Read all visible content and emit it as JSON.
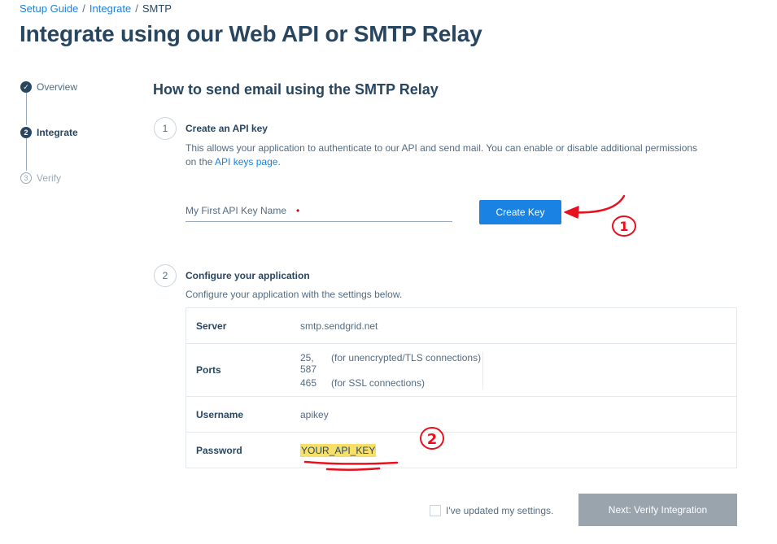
{
  "breadcrumb": {
    "items": [
      "Setup Guide",
      "Integrate",
      "SMTP"
    ],
    "separator": "/"
  },
  "page_title": "Integrate using our Web API or SMTP Relay",
  "steps": [
    {
      "label": "Overview",
      "status": "done",
      "marker": "✓"
    },
    {
      "label": "Integrate",
      "status": "active",
      "marker": "2"
    },
    {
      "label": "Verify",
      "status": "pending",
      "marker": "3"
    }
  ],
  "section_title": "How to send email using the SMTP Relay",
  "step1": {
    "number": "1",
    "title": "Create an API key",
    "desc_before": "This allows your application to authenticate to our API and send mail. You can enable or disable additional permissions on the ",
    "link": "API keys page",
    "desc_after": ".",
    "input_placeholder": "My First API Key Name",
    "required_marker": "•",
    "button": "Create Key"
  },
  "step2": {
    "number": "2",
    "title": "Configure your application",
    "desc": "Configure your application with the settings below.",
    "rows": {
      "server": {
        "key": "Server",
        "value": "smtp.sendgrid.net"
      },
      "ports": {
        "key": "Ports",
        "entries": [
          {
            "port": "25, 587",
            "note": "(for unencrypted/TLS connections)"
          },
          {
            "port": "465",
            "note": "(for SSL connections)"
          }
        ]
      },
      "username": {
        "key": "Username",
        "value": "apikey"
      },
      "password": {
        "key": "Password",
        "value": "YOUR_API_KEY"
      }
    }
  },
  "footer": {
    "checkbox_label": "I've updated my settings.",
    "checkbox_checked": false,
    "next_button": "Next: Verify Integration"
  },
  "annotations": {
    "mark1": "1",
    "mark2": "2",
    "color": "#e8111e"
  },
  "colors": {
    "accent": "#1a82e2",
    "text": "#294661",
    "muted": "#546b81",
    "highlight": "#f7e069",
    "disabled": "#9aa4ad"
  }
}
